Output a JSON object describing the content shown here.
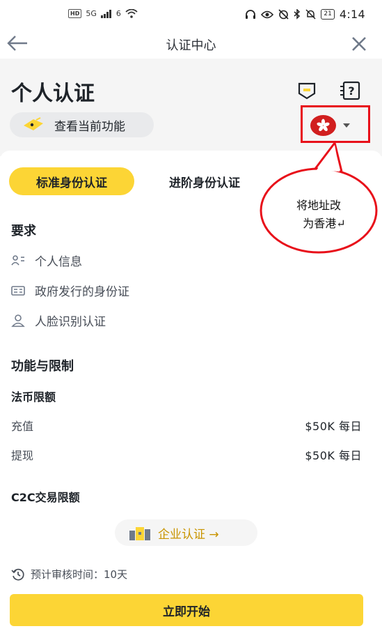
{
  "status_bar": {
    "hd": "HD",
    "signal": "5G",
    "wifi": "6",
    "battery": "21",
    "time": "4:14"
  },
  "nav": {
    "title": "认证中心"
  },
  "header": {
    "page_title": "个人认证",
    "features_label": "查看当前功能"
  },
  "tabs": [
    {
      "label": "标准身份认证",
      "active": true
    },
    {
      "label": "进阶身份认证",
      "active": false
    }
  ],
  "requirements": {
    "title": "要求",
    "items": [
      "个人信息",
      "政府发行的身份证",
      "人脸识别认证"
    ]
  },
  "limits": {
    "title": "功能与限制",
    "fiat_title": "法币限额",
    "rows": [
      {
        "label": "充值",
        "value": "$50K 每日"
      },
      {
        "label": "提现",
        "value": "$50K 每日"
      }
    ],
    "c2c_title": "C2C交易限额"
  },
  "business_button": "企业认证 →",
  "review_time": "预计审核时间：10天",
  "start_button": "立即开始",
  "annotation": {
    "line1": "将地址改",
    "line2": "为香港↵"
  },
  "colors": {
    "accent": "#fcd535",
    "annotation": "#e8101a",
    "flag": "#d11f1f"
  }
}
